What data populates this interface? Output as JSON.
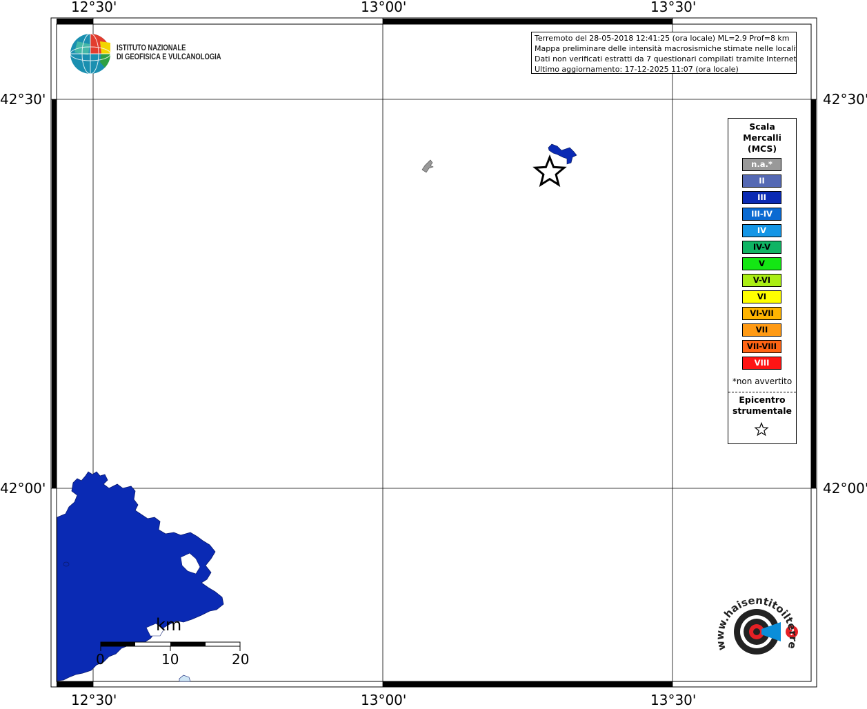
{
  "map": {
    "longitude_labels": [
      "12°30'",
      "13°00'",
      "13°30'"
    ],
    "latitude_labels": [
      "42°30'",
      "42°00'"
    ]
  },
  "info": {
    "line1": "Terremoto del 28-05-2018 12:41:25 (ora locale) ML=2.9 Prof=8 km",
    "line2": "Mappa preliminare delle intensità macrosismiche stimate nelle località",
    "line3": "Dati non verificati estratti da 7 questionari compilati tramite Internet.",
    "line4": "Ultimo aggiornamento: 17-12-2025 11:07 (ora locale)"
  },
  "logo_ingv": {
    "line1": "ISTITUTO NAZIONALE",
    "line2": "DI GEOFISICA E VULCANOLOGIA"
  },
  "legend": {
    "title_line1": "Scala",
    "title_line2": "Mercalli",
    "title_line3": "(MCS)",
    "items": [
      {
        "label": "n.a.*",
        "color": "#999999",
        "text_color": "#ffffff"
      },
      {
        "label": "II",
        "color": "#5569b4",
        "text_color": "#ffffff"
      },
      {
        "label": "III",
        "color": "#0a2ab4",
        "text_color": "#ffffff"
      },
      {
        "label": "III-IV",
        "color": "#0a6ad2",
        "text_color": "#ffffff"
      },
      {
        "label": "IV",
        "color": "#1496e6",
        "text_color": "#ffffff"
      },
      {
        "label": "IV-V",
        "color": "#0fb464",
        "text_color": "#000000"
      },
      {
        "label": "V",
        "color": "#14e614",
        "text_color": "#000000"
      },
      {
        "label": "V-VI",
        "color": "#aaee14",
        "text_color": "#000000"
      },
      {
        "label": "VI",
        "color": "#ffff00",
        "text_color": "#000000"
      },
      {
        "label": "VI-VII",
        "color": "#ffb400",
        "text_color": "#000000"
      },
      {
        "label": "VII",
        "color": "#ff9a14",
        "text_color": "#000000"
      },
      {
        "label": "VII-VIII",
        "color": "#ff6414",
        "text_color": "#000000"
      },
      {
        "label": "VIII",
        "color": "#ff1414",
        "text_color": "#ffffff"
      }
    ],
    "note": "*non avvertito",
    "epicenter_line1": "Epicentro",
    "epicenter_line2": "strumentale"
  },
  "scale_bar": {
    "unit": "km",
    "ticks": [
      "0",
      "10",
      "20"
    ]
  },
  "logo_hsit": {
    "text": "www.haisentitoilterremoto.it"
  },
  "colors": {
    "intensity_iii": "#0a2ab4",
    "not_felt": "#999999",
    "frame": "#000000"
  }
}
